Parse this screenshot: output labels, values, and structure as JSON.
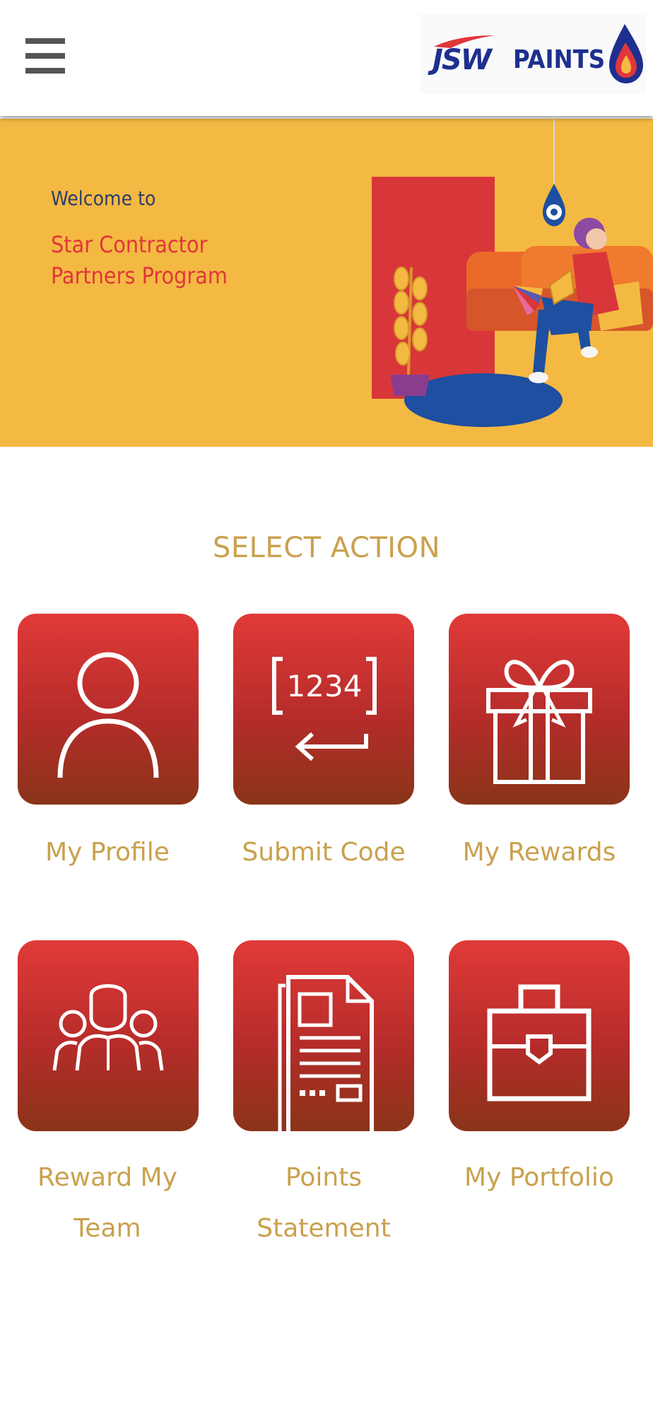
{
  "header": {
    "menu_icon": "hamburger-menu-icon",
    "logo_text": "JSW PAINTS",
    "colors": {
      "logo_blue": "#1e2f8f",
      "logo_red": "#e0373a"
    }
  },
  "banner": {
    "welcome": "Welcome to",
    "program_line1": "Star Contractor",
    "program_line2": "Partners Program",
    "colors": {
      "background": "#f4b942",
      "title": "#e0373a",
      "welcome": "#2c3d6b"
    }
  },
  "section_title": "SELECT ACTION",
  "actions": [
    {
      "label": "My Profile",
      "icon": "user-icon"
    },
    {
      "label": "Submit Code",
      "icon": "code-entry-icon",
      "icon_text": "1234"
    },
    {
      "label": "My Rewards",
      "icon": "gift-icon"
    },
    {
      "label_line1": "Reward My",
      "label_line2": "Team",
      "icon": "team-icon"
    },
    {
      "label_line1": "Points",
      "label_line2": "Statement",
      "icon": "document-icon"
    },
    {
      "label": "My Portfolio",
      "icon": "briefcase-icon"
    }
  ],
  "colors": {
    "tile_top": "#e03a38",
    "tile_bottom": "#8a3419",
    "label": "#c9a14d"
  }
}
